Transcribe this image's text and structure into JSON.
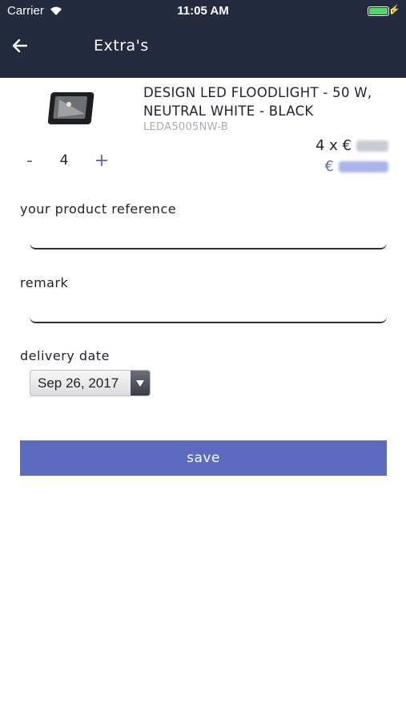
{
  "status_bar": {
    "carrier": "Carrier",
    "time": "11:05 AM"
  },
  "nav": {
    "title": "Extra's",
    "back_icon": "arrow-left-icon"
  },
  "product": {
    "name": "DESIGN LED FLOODLIGHT - 50 W, NEUTRAL WHITE - BLACK",
    "sku": "LEDA5005NW-B",
    "quantity": "4",
    "minus_label": "-",
    "plus_label": "+",
    "unit_price_prefix": "4 x €",
    "total_prefix": "€"
  },
  "form": {
    "reference_label": "your product reference",
    "reference_value": "",
    "remark_label": "remark",
    "remark_value": "",
    "delivery_label": "delivery date",
    "delivery_value": "Sep 26, 2017"
  },
  "save_label": "save",
  "colors": {
    "header": "#242b3e",
    "accent": "#5c6bc0",
    "battery": "#4cd964"
  }
}
